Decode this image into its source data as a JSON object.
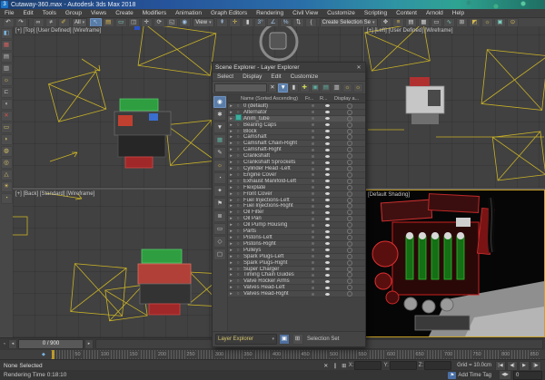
{
  "window": {
    "title": "Cutaway-360.max - Autodesk 3ds Max 2018",
    "app_icon_glyph": "3"
  },
  "menu_bar": {
    "items": [
      "File",
      "Edit",
      "Tools",
      "Group",
      "Views",
      "Create",
      "Modifiers",
      "Animation",
      "Graph Editors",
      "Rendering",
      "Civil View",
      "Customize",
      "Scripting",
      "Content",
      "Arnold",
      "Help"
    ]
  },
  "main_toolbar": {
    "items": [
      {
        "t": "i",
        "n": "undo-icon",
        "g": "↶"
      },
      {
        "t": "i",
        "n": "redo-icon",
        "g": "↷"
      },
      {
        "t": "s"
      },
      {
        "t": "i",
        "n": "select-and-link-icon",
        "g": "∞"
      },
      {
        "t": "i",
        "n": "unlink-selection-icon",
        "g": "≠"
      },
      {
        "t": "i",
        "n": "bind-to-space-warp-icon",
        "g": "✐",
        "c": "#d8b84f"
      },
      {
        "t": "d",
        "n": "selection-filter-dropdown",
        "v": "All"
      },
      {
        "t": "i",
        "n": "select-object-icon",
        "g": "↖",
        "c": "#9fc3e8",
        "sel": true
      },
      {
        "t": "i",
        "n": "select-by-name-icon",
        "g": "▤",
        "c": "#d8b84f"
      },
      {
        "t": "i",
        "n": "selection-region-icon",
        "g": "▭",
        "c": "#7fd0c0"
      },
      {
        "t": "i",
        "n": "window-crossing-icon",
        "g": "◫"
      },
      {
        "t": "i",
        "n": "select-and-move-icon",
        "g": "✛"
      },
      {
        "t": "i",
        "n": "select-and-rotate-icon",
        "g": "⟳"
      },
      {
        "t": "i",
        "n": "select-and-scale-icon",
        "g": "◱"
      },
      {
        "t": "i",
        "n": "select-and-place-icon",
        "g": "◉",
        "c": "#9fc3e8"
      },
      {
        "t": "d",
        "n": "reference-coordinate-dropdown",
        "v": "View"
      },
      {
        "t": "i",
        "n": "use-pivot-point-icon",
        "g": "⇞",
        "c": "#9fc3e8"
      },
      {
        "t": "i",
        "n": "select-and-manipulate-icon",
        "g": "✛",
        "c": "#d8b84f"
      },
      {
        "t": "i",
        "n": "keyboard-shortcut-override-icon",
        "g": "▮"
      },
      {
        "t": "i",
        "n": "snaps-toggle-icon",
        "g": "3°",
        "c": "#9fc3e8"
      },
      {
        "t": "i",
        "n": "angle-snap-icon",
        "g": "∠",
        "c": "#9fc3e8"
      },
      {
        "t": "i",
        "n": "percent-snap-icon",
        "g": "%",
        "c": "#9fc3e8"
      },
      {
        "t": "i",
        "n": "spinner-snap-icon",
        "g": "⇅"
      },
      {
        "t": "i",
        "n": "edit-named-selection-sets-icon",
        "g": "{"
      },
      {
        "t": "d",
        "n": "named-selection-sets-dropdown",
        "v": "Create Selection Se"
      },
      {
        "t": "i",
        "n": "mirror-icon",
        "g": "✥"
      },
      {
        "t": "i",
        "n": "align-icon",
        "g": "≡",
        "c": "#d8b84f"
      },
      {
        "t": "i",
        "n": "toggle-scene-explorer-icon",
        "g": "▤"
      },
      {
        "t": "i",
        "n": "toggle-layer-explorer-icon",
        "g": "▦"
      },
      {
        "t": "i",
        "n": "toggle-ribbon-icon",
        "g": "▭"
      },
      {
        "t": "i",
        "n": "curve-editor-icon",
        "g": "∿",
        "c": "#7fd0c0"
      },
      {
        "t": "i",
        "n": "schematic-view-icon",
        "g": "⊞"
      },
      {
        "t": "i",
        "n": "material-editor-icon",
        "g": "◩",
        "c": "#d8b84f"
      },
      {
        "t": "i",
        "n": "render-setup-icon",
        "g": "☼",
        "c": "#d8b84f"
      },
      {
        "t": "i",
        "n": "rendered-frame-window-icon",
        "g": "▣",
        "c": "#7fd0c0"
      },
      {
        "t": "i",
        "n": "render-production-icon",
        "g": "⊙",
        "c": "#d8b84f"
      }
    ]
  },
  "left_toolbar": {
    "icons": [
      {
        "n": "viewport-visual-style-icon",
        "g": "◧",
        "c": "#7ab4e0"
      },
      {
        "n": "render-preview-icon",
        "g": "▦",
        "c": "#d06060"
      },
      {
        "n": "layout-window-icon",
        "g": "▤",
        "c": "#bebebe"
      },
      {
        "n": "layout-window-alt-icon",
        "g": "▥",
        "c": "#bebebe"
      },
      {
        "n": "light-icon",
        "g": "☼",
        "c": "#e0c060"
      },
      {
        "n": "clamp-tool-icon",
        "g": "⊏",
        "c": "#bebebe"
      },
      {
        "n": "audio-tool-icon",
        "g": "◖",
        "c": "#bebebe"
      },
      {
        "n": "delete-tool-icon",
        "g": "✕",
        "c": "#d05050"
      },
      {
        "n": "primitive-box-icon",
        "g": "▭",
        "c": "#d8c36a"
      },
      {
        "n": "primitive-rounded-icon",
        "g": "◗",
        "c": "#d8c36a"
      },
      {
        "n": "primitive-blob-icon",
        "g": "◍",
        "c": "#d8c36a"
      },
      {
        "n": "primitive-disc-icon",
        "g": "◎",
        "c": "#d8c36a"
      },
      {
        "n": "primitive-cone-icon",
        "g": "△",
        "c": "#d8c36a"
      },
      {
        "n": "primitive-sun-icon",
        "g": "☀",
        "c": "#e0c060"
      },
      {
        "n": "primitive-dome-icon",
        "g": "◔",
        "c": "#d8c36a"
      }
    ]
  },
  "viewports": {
    "top_left": {
      "label": "[+] [Top] [User Defined] [Wireframe]"
    },
    "top_right": {
      "label": "[+] [Left] [User Defined] [Wireframe]"
    },
    "bottom_left": {
      "label": "[+] [Back] [Standard] [Wireframe]"
    },
    "bottom_right": {
      "label": "[Default Shading]"
    }
  },
  "scene_explorer": {
    "title": "Scene Explorer - Layer Explorer",
    "close_icon": "✕",
    "menus": [
      "Select",
      "Display",
      "Edit",
      "Customize"
    ],
    "search_value": "",
    "toolbar_icons": [
      {
        "n": "clear-search-icon",
        "g": "✕"
      },
      {
        "n": "filter-icon",
        "g": "▼",
        "sel": true
      },
      {
        "n": "lock-cell-editing-icon",
        "g": "▮"
      },
      {
        "n": "create-new-layer-icon",
        "g": "✚",
        "c": "#cbd65a"
      },
      {
        "n": "add-to-new-layer-icon",
        "g": "▣",
        "c": "#5fb0a0"
      },
      {
        "n": "add-to-active-layer-icon",
        "g": "▤",
        "c": "#5fb0a0"
      },
      {
        "n": "select-children-icon",
        "g": "▥"
      },
      {
        "n": "make-active-layer-icon",
        "g": "☼",
        "c": "#d8b84f"
      },
      {
        "n": "layer-properties-icon",
        "g": "☼",
        "c": "#d8b84f"
      }
    ],
    "filter_icons": [
      {
        "n": "display-all-icon",
        "g": "◉",
        "sel": true
      },
      {
        "n": "display-none-icon",
        "g": "✱"
      },
      {
        "n": "display-inverted-icon",
        "g": "▼"
      },
      {
        "n": "display-geometry-icon",
        "g": "▦",
        "c": "#5fb0a0"
      },
      {
        "n": "display-shapes-icon",
        "g": "✎"
      },
      {
        "n": "display-lights-icon",
        "g": "☼",
        "c": "#d8b84f"
      },
      {
        "n": "display-cameras-icon",
        "g": "◔"
      },
      {
        "n": "display-helpers-icon",
        "g": "✦"
      },
      {
        "n": "display-space-warps-icon",
        "g": "⚑"
      },
      {
        "n": "display-groups-icon",
        "g": "≣"
      },
      {
        "n": "display-xrefs-icon",
        "g": "▭"
      },
      {
        "n": "display-materials-icon",
        "g": "◇"
      },
      {
        "n": "display-bones-icon",
        "g": "▢"
      }
    ],
    "columns": {
      "name": "Name (Sorted Ascending)",
      "frozen": "Fr...",
      "render": "R...",
      "display": "Display a..."
    },
    "selected_layer_index": 2,
    "layers": [
      "0 (default)",
      "Alternator",
      "Anim_tube",
      "Bearing Caps",
      "Block",
      "Camshaft",
      "Camshaft Chain-Right",
      "Camshaft-Right",
      "Crankshaft",
      "Crankshaft Sprockets",
      "Cylinder Head -Left",
      "Engine Cover",
      "Exhaust Manifold-Left",
      "Flexplate",
      "Front Cover",
      "Fuel Injections-Left",
      "Fuel Injections-Right",
      "Oil Filter",
      "Oil Pan",
      "Oil Pump Housing",
      "Parts",
      "Pistons-Left",
      "Pistons-Right",
      "Pulleys",
      "Spark Plugs-Left",
      "Spark Plugs-Right",
      "Super Charger",
      "Timing Chain Guides",
      "Valve Rocker Arms",
      "Valves Head-Left",
      "Valves Head-Right"
    ],
    "footer": {
      "mode": "Layer Explorer",
      "selection_set": "Selection Set"
    }
  },
  "timeline": {
    "listener_icon": "◔",
    "prev_icon": "◂",
    "next_icon": "▸",
    "time_display": "0 / 900",
    "trackbar_icon": "◆",
    "tick_labels": [
      "0",
      "50",
      "100",
      "150",
      "200",
      "250",
      "300",
      "350",
      "400",
      "450",
      "500",
      "550",
      "600",
      "650",
      "700",
      "750",
      "800",
      "850"
    ]
  },
  "status_bar": {
    "selection_status": "None Selected",
    "clear_icon": "✕",
    "isolate_icon": "∥",
    "offset_mode_icon": "⊞",
    "x_label": "X:",
    "y_label": "Y:",
    "z_label": "Z:",
    "x_value": "",
    "y_value": "",
    "z_value": "",
    "grid_label": "Grid = 10.0cm",
    "rendering_time": "Rendering Time 0:18:10",
    "add_time_tag": "Add Time Tag",
    "tag_icon": "⚑",
    "key_mode_icon": "◀▶",
    "frame_value": "0",
    "playback": [
      {
        "n": "go-to-start-button",
        "g": "|◀"
      },
      {
        "n": "previous-frame-button",
        "g": "◀|"
      },
      {
        "n": "play-button",
        "g": "▶"
      },
      {
        "n": "next-frame-button",
        "g": "|▶"
      }
    ]
  }
}
